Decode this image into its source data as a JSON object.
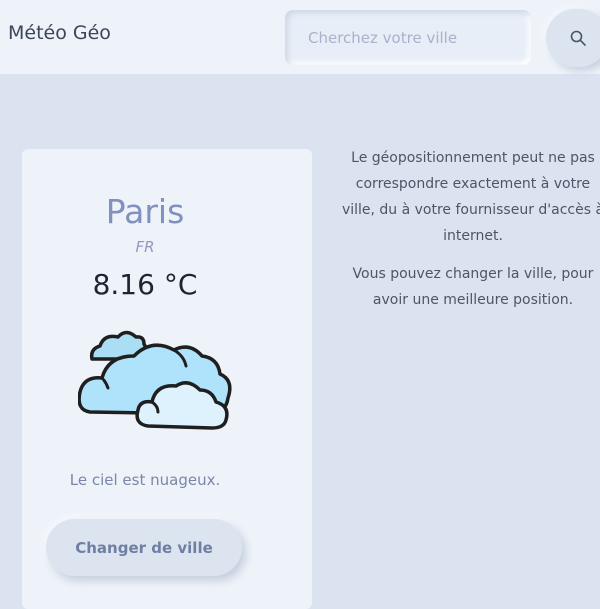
{
  "header": {
    "brand": "Météo Géo",
    "search_placeholder": "Cherchez votre ville"
  },
  "weather": {
    "city": "Paris",
    "country": "FR",
    "temperature": "8.16 °C",
    "description": "Le ciel est nuageux.",
    "icon": "cloudy-icon",
    "change_city_label": "Changer de ville"
  },
  "info": {
    "paragraph_1": "Le géopositionnement peut ne pas correspondre exactement à votre ville, du à votre fournisseur d'accès à internet.",
    "paragraph_2": "Vous pouvez changer la ville, pour avoir une meilleure position."
  },
  "colors": {
    "background": "#dbe3f1",
    "card": "#eef3f9",
    "accent": "#8090bf"
  }
}
